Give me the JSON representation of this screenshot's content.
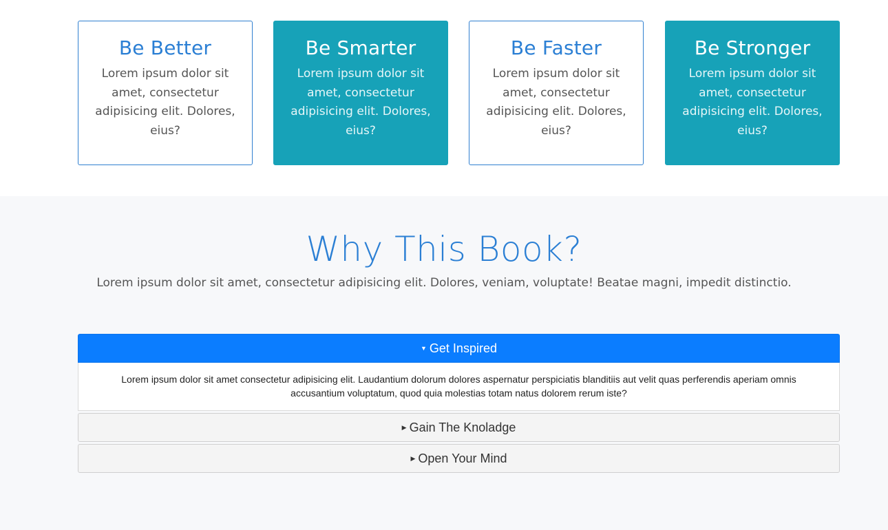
{
  "features": [
    {
      "title": "Be Better",
      "text": "Lorem ipsum dolor sit amet, consectetur adipisicing elit. Dolores, eius?"
    },
    {
      "title": "Be Smarter",
      "text": "Lorem ipsum dolor sit amet, consectetur adipisicing elit. Dolores, eius?"
    },
    {
      "title": "Be Faster",
      "text": "Lorem ipsum dolor sit amet, consectetur adipisicing elit. Dolores, eius?"
    },
    {
      "title": "Be Stronger",
      "text": "Lorem ipsum dolor sit amet, consectetur adipisicing elit. Dolores, eius?"
    }
  ],
  "why": {
    "title": "Why This Book?",
    "lead": "Lorem ipsum dolor sit amet, consectetur adipisicing elit. Dolores, veniam, voluptate! Beatae magni, impedit distinctio."
  },
  "accordion": [
    {
      "label": "Get Inspired",
      "expanded": true,
      "body": "Lorem ipsum dolor sit amet consectetur adipisicing elit. Laudantium dolorum dolores aspernatur perspiciatis blanditiis aut velit quas perferendis aperiam omnis accusantium voluptatum, quod quia molestias totam natus dolorem rerum iste?"
    },
    {
      "label": "Gain The Knoladge",
      "expanded": false
    },
    {
      "label": "Open Your Mind",
      "expanded": false
    }
  ],
  "colors": {
    "accent_blue": "#2b7fd4",
    "teal": "#17a2b8",
    "primary": "#0b7dff",
    "section_bg": "#f7f8fa"
  },
  "icons": {
    "expanded": "caret-down-icon",
    "collapsed": "caret-right-icon"
  }
}
